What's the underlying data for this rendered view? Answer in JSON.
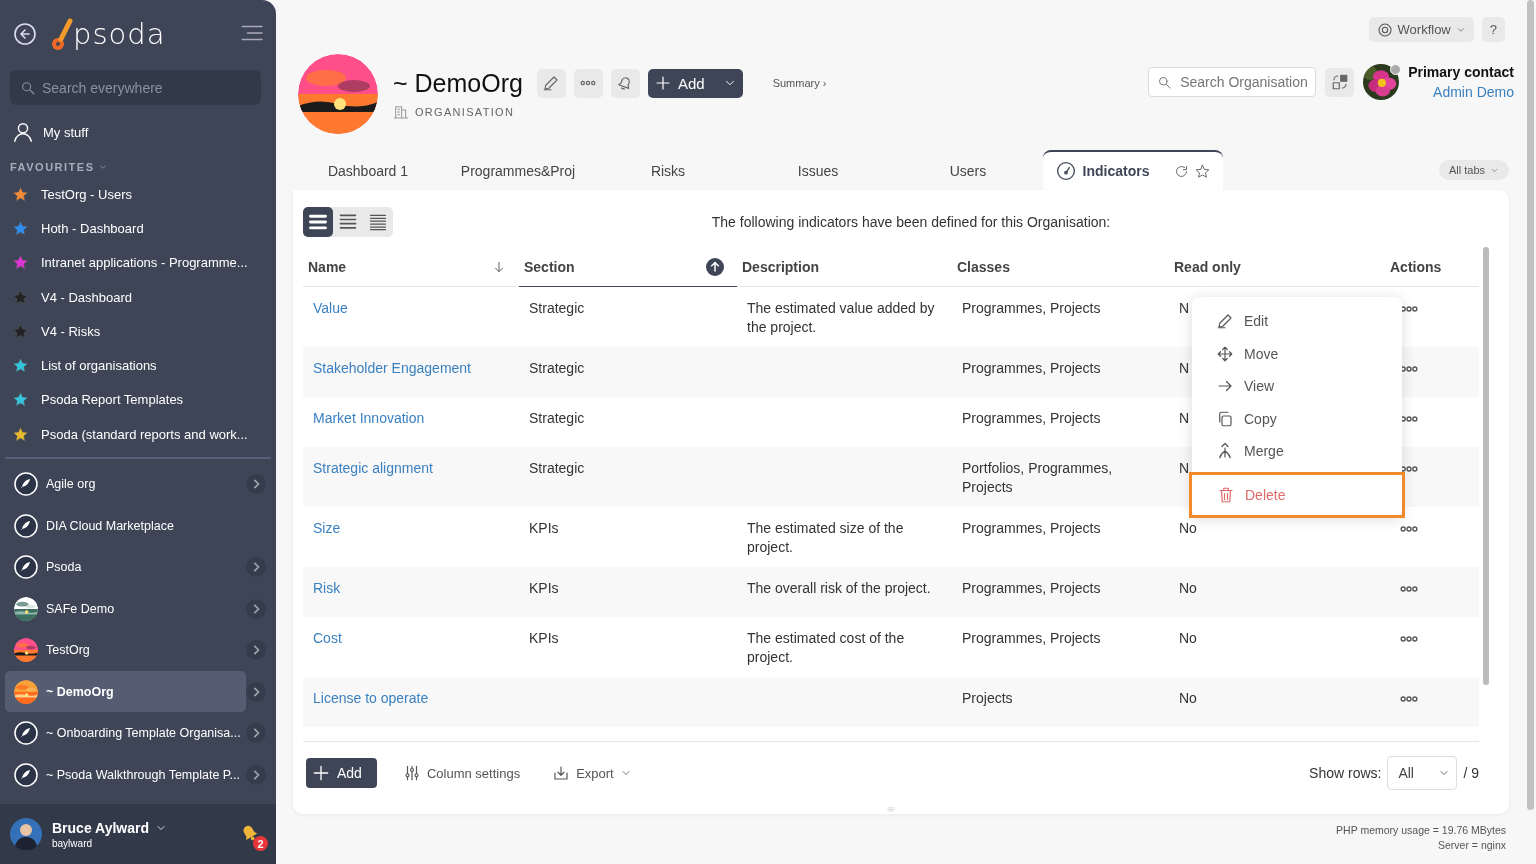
{
  "sidebar": {
    "logo": "psoda",
    "search": {
      "placeholder": "Search everywhere"
    },
    "my_stuff": "My stuff",
    "favourites_title": "FAVOURITES",
    "favourites": [
      {
        "label": "TestOrg - Users",
        "color": "#f28c38"
      },
      {
        "label": "Hoth - Dashboard",
        "color": "#2f8ff0"
      },
      {
        "label": "Intranet applications - Programme...",
        "color": "#e033d8"
      },
      {
        "label": "V4 - Dashboard",
        "color": "#222222"
      },
      {
        "label": "V4 - Risks",
        "color": "#222222"
      },
      {
        "label": "List of organisations",
        "color": "#35c4dd"
      },
      {
        "label": "Psoda Report Templates",
        "color": "#35c4dd"
      },
      {
        "label": "Psoda (standard reports and work...",
        "color": "#e6b92e"
      }
    ],
    "organisations": [
      {
        "label": "Agile org",
        "kind": "rocket",
        "expandable": true,
        "selected": false
      },
      {
        "label": "DIA Cloud Marketplace",
        "kind": "rocket",
        "expandable": false,
        "selected": false
      },
      {
        "label": "Psoda",
        "kind": "rocket",
        "expandable": true,
        "selected": false
      },
      {
        "label": "SAFe Demo",
        "kind": "picture",
        "expandable": true,
        "selected": false
      },
      {
        "label": "TestOrg",
        "kind": "picture",
        "expandable": true,
        "selected": false
      },
      {
        "label": "~ DemoOrg",
        "kind": "picture",
        "expandable": true,
        "selected": true
      },
      {
        "label": "~ Onboarding Template Organisa...",
        "kind": "rocket",
        "expandable": true,
        "selected": false
      },
      {
        "label": "~ Psoda Walkthrough Template P...",
        "kind": "rocket",
        "expandable": true,
        "selected": false
      }
    ],
    "user": {
      "name": "Bruce Aylward",
      "username": "baylward",
      "notifications": "2"
    }
  },
  "top_bar": {
    "workflow": "Workflow",
    "help": "?"
  },
  "header": {
    "title": "~ DemoOrg",
    "type": "ORGANISATION",
    "add": "Add",
    "summary": "Summary ›",
    "search": {
      "placeholder": "Search Organisation"
    },
    "contact_label": "Primary contact",
    "contact_name": "Admin Demo"
  },
  "tabs": [
    {
      "label": "Dashboard 1",
      "selected": false
    },
    {
      "label": "Programmes&Proj",
      "selected": false
    },
    {
      "label": "Risks",
      "selected": false
    },
    {
      "label": "Issues",
      "selected": false
    },
    {
      "label": "Users",
      "selected": false
    },
    {
      "label": "Indicators",
      "selected": true
    }
  ],
  "all_tabs": "All tabs",
  "view_modes": [
    {
      "selected": true
    },
    {
      "selected": false
    },
    {
      "selected": false
    }
  ],
  "intro": "The following indicators have been defined for this Organisation:",
  "table": {
    "columns": [
      {
        "label": "Name",
        "sort_up": false,
        "active": false
      },
      {
        "label": "Section",
        "sort_up": true,
        "active": true
      },
      {
        "label": "Description"
      },
      {
        "label": "Classes"
      },
      {
        "label": "Read only"
      },
      {
        "label": "Actions"
      }
    ],
    "rows": [
      {
        "name": "Value",
        "section": "Strategic",
        "description": "The estimated value added by the project.",
        "classes": "Programmes, Projects",
        "read_only": "N"
      },
      {
        "name": "Stakeholder Engagement",
        "section": "Strategic",
        "classes": "Programmes, Projects",
        "read_only": "N"
      },
      {
        "name": "Market Innovation",
        "section": "Strategic",
        "classes": "Programmes, Projects",
        "read_only": "N"
      },
      {
        "name": "Strategic alignment",
        "section": "Strategic",
        "classes": "Portfolios, Programmes, Projects",
        "read_only": "N"
      },
      {
        "name": "Size",
        "section": "KPIs",
        "description": "The estimated size of the project.",
        "classes": "Programmes, Projects",
        "read_only": "No"
      },
      {
        "name": "Risk",
        "section": "KPIs",
        "description": "The overall risk of the project.",
        "classes": "Programmes, Projects",
        "read_only": "No"
      },
      {
        "name": "Cost",
        "section": "KPIs",
        "description": "The estimated cost of the project.",
        "classes": "Programmes, Projects",
        "read_only": "No"
      },
      {
        "name": "License to operate",
        "classes": "Projects",
        "read_only": "No"
      }
    ]
  },
  "action_menu": [
    {
      "label": "Edit",
      "kind": "normal",
      "highlighted": false
    },
    {
      "label": "Move",
      "kind": "normal",
      "highlighted": false
    },
    {
      "label": "View",
      "kind": "normal",
      "highlighted": false
    },
    {
      "label": "Copy",
      "kind": "normal",
      "highlighted": false
    },
    {
      "label": "Merge",
      "kind": "normal",
      "highlighted": false
    },
    {
      "label": "Delete",
      "kind": "danger",
      "highlighted": true
    }
  ],
  "table_footer": {
    "add": "Add",
    "column_settings": "Column settings",
    "export": "Export",
    "show_rows_label": "Show rows:",
    "show_rows_value": "All",
    "total": "/ 9"
  },
  "page_footer": [
    "PHP memory usage = 19.76 MBytes",
    "Server = nginx"
  ]
}
